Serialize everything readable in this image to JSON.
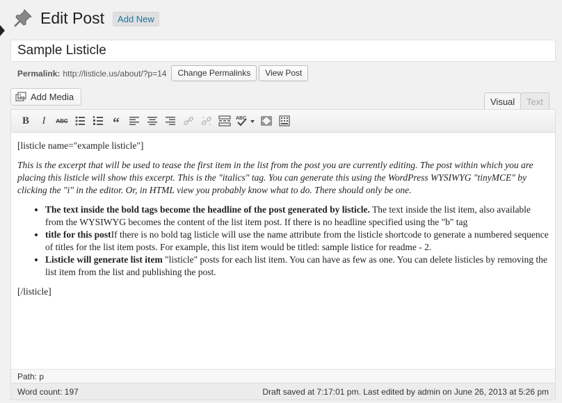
{
  "header": {
    "title": "Edit Post",
    "add_new_label": "Add New"
  },
  "post": {
    "title_value": "Sample Listicle",
    "permalink_label": "Permalink:",
    "permalink_url": "http://listicle.us/about/?p=14",
    "change_permalinks_label": "Change Permalinks",
    "view_post_label": "View Post"
  },
  "editor": {
    "add_media_label": "Add Media",
    "tabs": [
      {
        "label": "Visual",
        "active": true
      },
      {
        "label": "Text",
        "active": false
      }
    ],
    "toolbar": {
      "bold_label": "B",
      "italic_label": "I",
      "strike_label": "ABC",
      "quote_label": "“",
      "spell_label": "ABC"
    },
    "content": {
      "open_shortcode": "[listicle name=\"example listicle\"]",
      "excerpt": "This is the excerpt that will be used to tease the first item in the list from the post you are currently editing. The post within which you are placing this listicle will show this excerpt. This is the \"italics\" tag. You can generate this using the WordPress WYSIWYG \"tinyMCE\" by clicking the \"i\" in the editor. Or, in HTML view you probably know what to do. There should only be one.",
      "items": [
        {
          "bold": "The text inside the bold tags become the headline of the post generated by listicle.",
          "text": " The text inside the list item, also available from the WYSIWYG becomes the content of the list item post. If there is no headline specified using the \"b\" tag"
        },
        {
          "bold": "title for this post",
          "text": "If there is no bold tag listicle will use the name attribute from the listicle shortcode to generate a numbered sequence of titles for the list item posts. For example, this list item would be titled: sample listice for readme - 2."
        },
        {
          "bold": "Listicle will generate list item",
          "text": " \"listicle\" posts for each list item. You can have as few as one. You can delete listicles by removing the list item from the list and publishing the post."
        }
      ],
      "close_shortcode": "[/listicle]"
    },
    "path": "Path: p",
    "word_count": "Word count: 197",
    "draft_status": "Draft saved at 7:17:01 pm. Last edited by admin on June 26, 2013 at 5:26 pm"
  }
}
